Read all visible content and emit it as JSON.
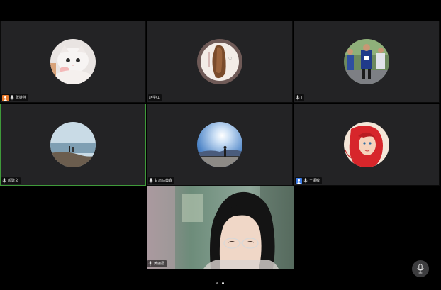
{
  "participants": [
    {
      "name": "张娃伴",
      "badge": "orange-person-icon",
      "avatar": "cat-photo"
    },
    {
      "name": "赵学红",
      "badge": "",
      "avatar": "woman-back-photo"
    },
    {
      "name": "J",
      "badge": "",
      "avatar": "runners-photo"
    },
    {
      "name": "颜建文",
      "badge": "",
      "avatar": "seaside-photo"
    },
    {
      "name": "甘肃马典鑫",
      "badge": "",
      "avatar": "sunrise-photo"
    },
    {
      "name": "王振敏",
      "badge": "blue-person-icon",
      "avatar": "cartoon-mermaid"
    }
  ],
  "active_video": {
    "name": "黄丽霞"
  },
  "pager": {
    "pages": 2,
    "current": 2
  },
  "colors": {
    "active_speaker_border": "#3f9a3a",
    "orange_badge": "#e8792b",
    "blue_badge": "#3d7ce6"
  }
}
